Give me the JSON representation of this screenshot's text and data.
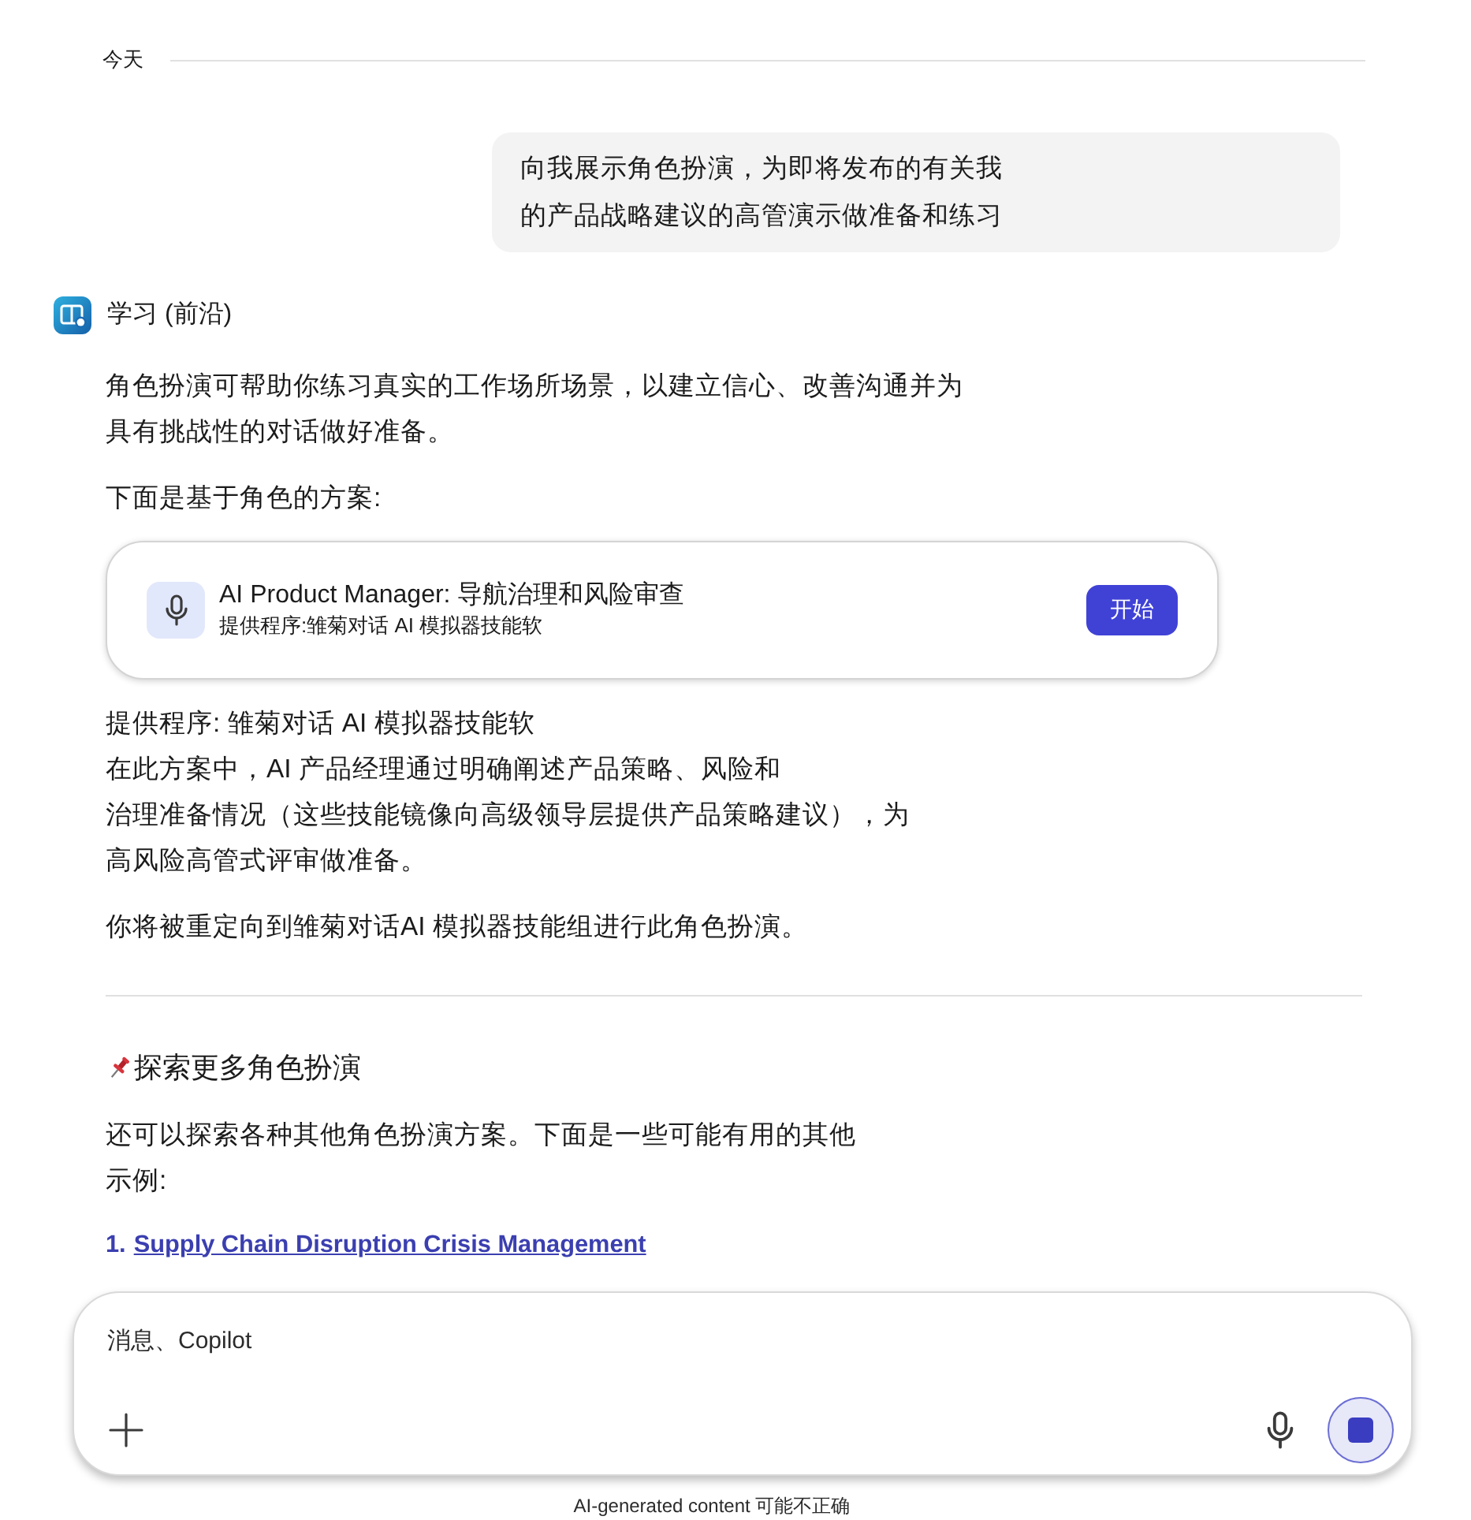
{
  "date_divider": {
    "label": "今天"
  },
  "user_message": {
    "text": "向我展示角色扮演，为即将发布的有关我的产品战略建议的高管演示做准备和练习"
  },
  "assistant": {
    "name": "学习 (前沿)"
  },
  "response": [
    {
      "kind": "paragraph",
      "lines": [
        "角色扮演可帮助你练习真实的工作场所场景，以建立信心、改善沟通并为",
        "具有挑战性的对话做好准备。"
      ]
    },
    {
      "kind": "paragraph",
      "lines": [
        "下面是基于角色的方案:"
      ]
    },
    {
      "kind": "scenario_card",
      "title": "AI Product Manager: 导航治理和风险审查",
      "subtitle": "提供程序:雏菊对话 AI 模拟器技能软",
      "button": "开始"
    },
    {
      "kind": "paragraph",
      "lines": [
        "提供程序: 雏菊对话 AI 模拟器技能软",
        "在此方案中，AI 产品经理通过明确阐述产品策略、风险和",
        "治理准备情况（这些技能镜像向高级领导层提供产品策略建议），为",
        "高风险高管式评审做准备。"
      ]
    },
    {
      "kind": "paragraph",
      "lines": [
        "你将被重定向到雏菊对话AI 模拟器技能组进行此角色扮演。"
      ]
    },
    {
      "kind": "divider"
    },
    {
      "kind": "heading",
      "text": "探索更多角色扮演"
    },
    {
      "kind": "paragraph",
      "lines": [
        "还可以探索各种其他角色扮演方案。下面是一些可能有用的其他",
        "示例:"
      ]
    },
    {
      "kind": "numbered_link",
      "number": "1.",
      "text": "Supply Chain Disruption Crisis Management"
    }
  ],
  "composer": {
    "placeholder": "消息、Copilot"
  },
  "footer": {
    "disclaimer": "AI-generated content 可能不正确"
  }
}
